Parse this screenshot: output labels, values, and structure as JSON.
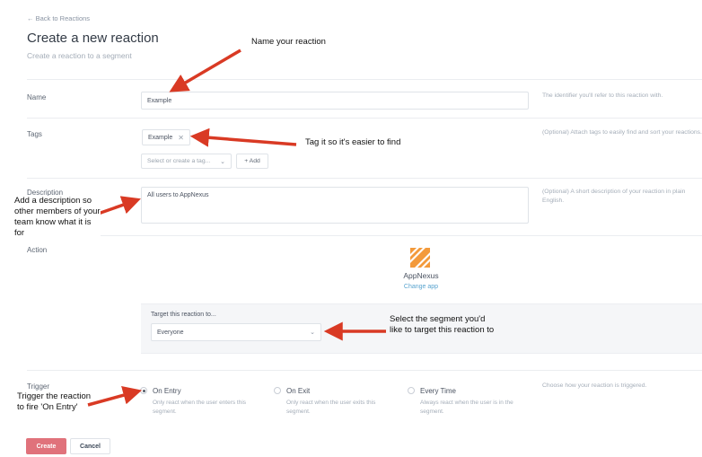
{
  "nav": {
    "back_label": "← Back to Reactions"
  },
  "header": {
    "title": "Create a new reaction",
    "subtitle": "Create a reaction to a segment"
  },
  "form": {
    "name": {
      "label": "Name",
      "value": "Example",
      "help": "The identifier you'll refer to this reaction with."
    },
    "tags": {
      "label": "Tags",
      "chips": [
        "Example"
      ],
      "remove_glyph": "✕",
      "select_placeholder": "Select or create a tag...",
      "add_label": "+ Add",
      "help": "(Optional) Attach tags to easily find and sort your reactions."
    },
    "description": {
      "label": "Description",
      "value": "All users to AppNexus",
      "help": "(Optional) A short description of your reaction in plain English."
    },
    "action": {
      "label": "Action",
      "app_name": "AppNexus",
      "change_app": "Change app",
      "target_label": "Target this reaction to...",
      "target_value": "Everyone"
    },
    "trigger": {
      "label": "Trigger",
      "help": "Choose how your reaction is triggered.",
      "options": [
        {
          "title": "On Entry",
          "desc": "Only react when the user enters this segment.",
          "selected": true
        },
        {
          "title": "On Exit",
          "desc": "Only react when the user exits this segment.",
          "selected": false
        },
        {
          "title": "Every Time",
          "desc": "Always react when the user is in the segment.",
          "selected": false
        }
      ]
    }
  },
  "buttons": {
    "create": "Create",
    "cancel": "Cancel"
  },
  "annotations": {
    "name": "Name your reaction",
    "tag": "Tag it so it's easier to find",
    "description": "Add a description so other members of your team know what it is for",
    "segment": "Select the segment you'd like to target this reaction to",
    "trigger": "Trigger the reaction to fire 'On Entry'"
  },
  "colors": {
    "primary": "#e0727b",
    "link": "#5aa4cf",
    "logo": "#f39a3b",
    "arrow": "#d93a24"
  },
  "icons": {
    "select_caret": "chevron-down-icon",
    "logo": "appnexus-logo-icon"
  }
}
